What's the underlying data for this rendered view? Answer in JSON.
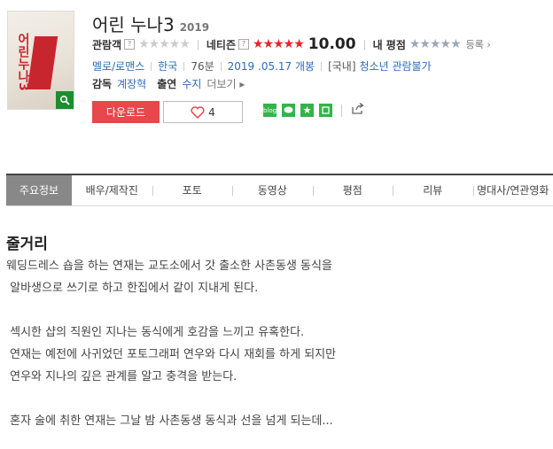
{
  "movie": {
    "title": "어린 누나3",
    "year": "2019",
    "poster_title_art": "어린누나3",
    "ratings": {
      "audience_label": "관람객",
      "audience_stars": "★★★★★",
      "netizen_label": "네티즌",
      "netizen_stars": "★★★★★",
      "netizen_score": "10.00",
      "my_label": "내 평점",
      "my_stars": "★★★★★",
      "register_label": "등록",
      "help_mark": "?"
    },
    "info": {
      "genre": "멜로/로맨스",
      "country": "한국",
      "runtime": "76분",
      "release": "2019 .05.17 개봉",
      "rating_region": "[국내]",
      "rating": "청소년 관람불가"
    },
    "director_label": "감독",
    "director": "계장혁",
    "cast_label": "출연",
    "cast": "수지",
    "more_label": "더보기"
  },
  "actions": {
    "download_label": "다운로드",
    "like_count": "4",
    "blog_label": "blog"
  },
  "tabs": [
    {
      "label": "주요정보"
    },
    {
      "label": "배우/제작진"
    },
    {
      "label": "포토"
    },
    {
      "label": "동영상"
    },
    {
      "label": "평점"
    },
    {
      "label": "리뷰"
    },
    {
      "label": "명대사/연관영화"
    }
  ],
  "synopsis": {
    "heading": "줄거리",
    "lines": [
      "웨딩드레스 숍을 하는 연재는 교도소에서 갓 출소한 사촌동생 동식을",
      " 알바생으로 쓰기로 하고 한집에서 같이 지내게 된다.",
      "",
      " 섹시한 샵의 직원인 지나는 동식에게 호감을 느끼고 유혹한다.",
      " 연재는 예전에 사귀었던 포토그래퍼 연우와 다시 재회를 하게 되지만",
      " 연우와 지나의 깊은 관계를 알고 충격을 받는다.",
      "",
      " 혼자 술에 취한 연재는 그날 밤 사촌동생 동식과 선을 넘게 되는데..."
    ]
  },
  "colors": {
    "accent_red": "#e8474b",
    "star_red": "#e8232a",
    "link_blue": "#2e6bb8",
    "active_tab": "#888888",
    "share_green": "#35b34a"
  }
}
